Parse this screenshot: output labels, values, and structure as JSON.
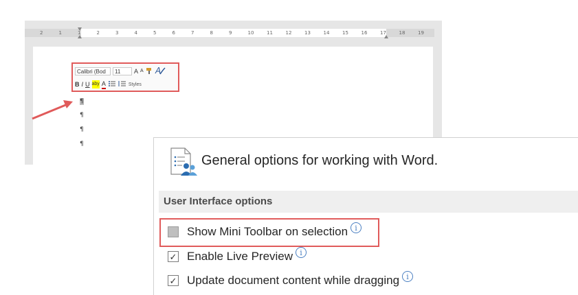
{
  "ruler": {
    "ticks": [
      "2",
      "1",
      "1",
      "2",
      "3",
      "4",
      "5",
      "6",
      "7",
      "8",
      "9",
      "10",
      "11",
      "12",
      "13",
      "14",
      "15",
      "16",
      "17",
      "18",
      "19"
    ]
  },
  "mini_toolbar": {
    "font_name": "Calibri (Bod",
    "font_size": "11",
    "grow_font": "A",
    "shrink_font": "A",
    "bold": "B",
    "italic": "I",
    "underline": "U",
    "highlight": "aby",
    "font_color": "A",
    "styles": "Styles"
  },
  "document": {
    "pilcrow": "¶"
  },
  "options": {
    "header": "General options for working with Word.",
    "section_title": "User Interface options",
    "items": [
      {
        "label": "Show Mini Toolbar on selection",
        "checked": false
      },
      {
        "label": "Enable Live Preview",
        "checked": true
      },
      {
        "label": "Update document content while dragging",
        "checked": true
      }
    ],
    "info_glyph": "i",
    "check_glyph": "✓"
  },
  "colors": {
    "highlight_red": "#e05a5a",
    "info_blue": "#4a7fc1"
  }
}
